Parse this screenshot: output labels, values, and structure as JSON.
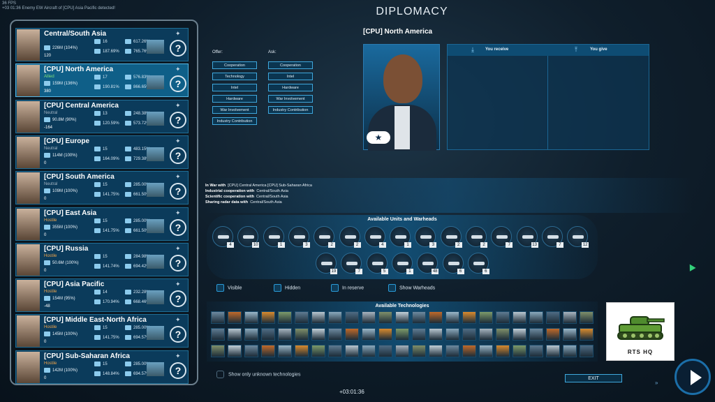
{
  "topbar": {
    "fps": "36 FPS",
    "alert": "+03 01:36  Enemy EW Aircraft of [CPU] Asia Pacific detected!"
  },
  "title": "DIPLOMACY",
  "selected_country": "[CPU] North America",
  "offer": {
    "label": "Offer:",
    "buttons": [
      "Cooperation",
      "Technology",
      "Intel",
      "Hardware",
      "War Involvement",
      "Industry Contribution"
    ]
  },
  "ask": {
    "label": "Ask:",
    "buttons": [
      "Cooperation",
      "Intel",
      "Hardware",
      "War Involvement",
      "Industry Contribution"
    ]
  },
  "trade": {
    "receive": "You receive",
    "give": "You give"
  },
  "relations": [
    {
      "label": "In War with",
      "value": "[CPU] Central America    [CPU] Sub-Saharan Africa"
    },
    {
      "label": "Industrial cooperation with",
      "value": "Central/South Asia"
    },
    {
      "label": "Scientific cooperation with",
      "value": "Central/South Asia"
    },
    {
      "label": "Sharing radar data with",
      "value": "Central/South Asia"
    }
  ],
  "units_title": "Available Units and Warheads",
  "units_row1": [
    "4",
    "10",
    "1",
    "3",
    "2",
    "2",
    "4",
    "1",
    "3",
    "2",
    "2",
    "7",
    "13",
    "7",
    "12"
  ],
  "units_row2": [
    "19",
    "7",
    "5",
    "1",
    "48",
    "6",
    "6"
  ],
  "filters": [
    "Visible",
    "Hidden",
    "In reserve",
    "Show Warheads"
  ],
  "tech_title": "Available Technologies",
  "show_unknown": "Show only unknown technologies",
  "exit": "EXIT",
  "bottom_time": "+03:01:36",
  "logo_text": "RTS HQ",
  "countries": [
    {
      "name": "Central/South Asia",
      "status": "",
      "pop": "226M (104%)",
      "bal": "120",
      "v1": "16",
      "v2": "187.69%",
      "v3": "617.26%",
      "v4": "765.76%"
    },
    {
      "name": "[CPU] North America",
      "status": "Allied",
      "pop": "159M (136%)",
      "bal": "380",
      "v1": "17",
      "v2": "190.81%",
      "v3": "576.83%",
      "v4": "866.65%"
    },
    {
      "name": "[CPU] Central America",
      "status": "Neutral",
      "pop": "90.8M (90%)",
      "bal": "-164",
      "v1": "13",
      "v2": "120.59%",
      "v3": "248.38%",
      "v4": "573.72%"
    },
    {
      "name": "[CPU] Europe",
      "status": "Neutral",
      "pop": "114M (100%)",
      "bal": "0",
      "v1": "15",
      "v2": "164.09%",
      "v3": "483.15%",
      "v4": "729.38%"
    },
    {
      "name": "[CPU] South America",
      "status": "Neutral",
      "pop": "109M (100%)",
      "bal": "0",
      "v1": "15",
      "v2": "141.75%",
      "v3": "285.00%",
      "v4": "661.50%"
    },
    {
      "name": "[CPU] East Asia",
      "status": "Hostile",
      "pop": "355M (100%)",
      "bal": "0",
      "v1": "15",
      "v2": "141.75%",
      "v3": "285.00%",
      "v4": "661.50%"
    },
    {
      "name": "[CPU] Russia",
      "status": "Hostile",
      "pop": "50.6M (100%)",
      "bal": "0",
      "v1": "15",
      "v2": "141.74%",
      "v3": "284.98%",
      "v4": "694.42%"
    },
    {
      "name": "[CPU] Asia Pacific",
      "status": "Hostile",
      "pop": "154M (95%)",
      "bal": "-48",
      "v1": "14",
      "v2": "170.94%",
      "v3": "232.28%",
      "v4": "668.46%"
    },
    {
      "name": "[CPU] Middle East-North Africa",
      "status": "Hostile",
      "pop": "145M (100%)",
      "bal": "0",
      "v1": "15",
      "v2": "141.75%",
      "v3": "285.00%",
      "v4": "694.57%"
    },
    {
      "name": "[CPU] Sub-Saharan Africa",
      "status": "Hostile",
      "pop": "142M (100%)",
      "bal": "0",
      "v1": "15",
      "v2": "148.84%",
      "v3": "285.00%",
      "v4": "694.57%"
    }
  ],
  "colors": {
    "accent": "#3fa8dd",
    "allied": "#7ee07a",
    "hostile": "#f0a44a"
  },
  "icons": [
    "cursor-icon",
    "play-icon",
    "fast-forward-icon",
    "receive-arrow-icon",
    "give-arrow-icon",
    "question-icon"
  ]
}
